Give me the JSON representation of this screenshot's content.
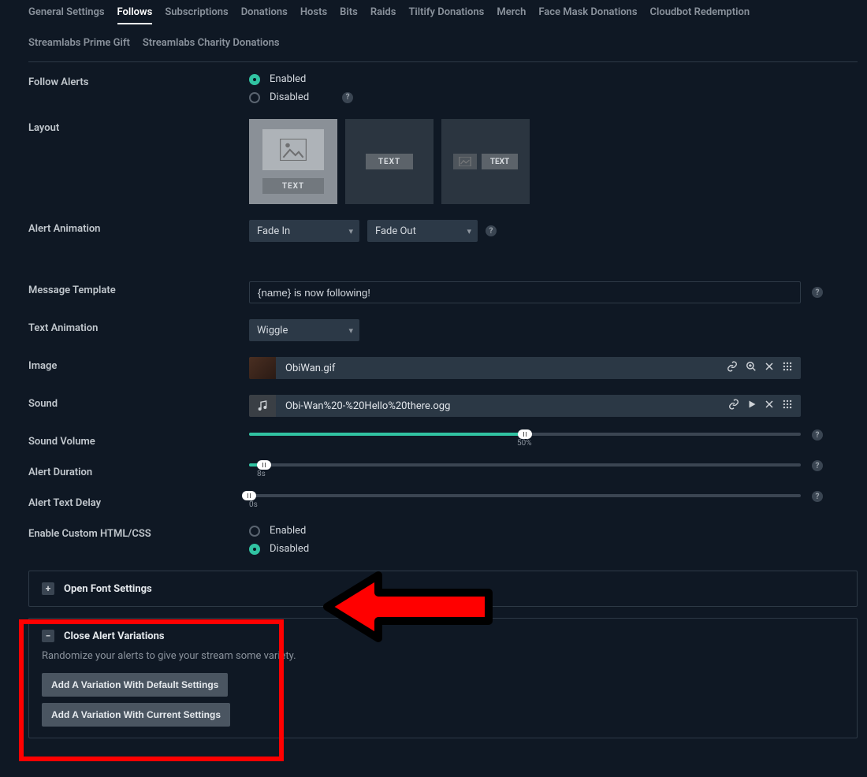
{
  "tabs": [
    "General Settings",
    "Follows",
    "Subscriptions",
    "Donations",
    "Hosts",
    "Bits",
    "Raids",
    "Tiltify Donations",
    "Merch",
    "Face Mask Donations",
    "Cloudbot Redemption",
    "Streamlabs Prime Gift",
    "Streamlabs Charity Donations"
  ],
  "active_tab_index": 1,
  "sections": {
    "follow_alerts": {
      "label": "Follow Alerts",
      "enabled": "Enabled",
      "disabled": "Disabled",
      "value": "enabled"
    },
    "layout": {
      "label": "Layout",
      "text_badge": "TEXT"
    },
    "alert_animation": {
      "label": "Alert Animation",
      "in": "Fade In",
      "out": "Fade Out"
    },
    "message_template": {
      "label": "Message Template",
      "value": "{name} is now following!"
    },
    "text_animation": {
      "label": "Text Animation",
      "value": "Wiggle"
    },
    "image": {
      "label": "Image",
      "file": "ObiWan.gif"
    },
    "sound": {
      "label": "Sound",
      "file": "Obi-Wan%20-%20Hello%20there.ogg"
    },
    "sound_volume": {
      "label": "Sound Volume",
      "value": 50,
      "display": "50%"
    },
    "alert_duration": {
      "label": "Alert Duration",
      "value": 8,
      "max": 300,
      "display": "8s"
    },
    "alert_text_delay": {
      "label": "Alert Text Delay",
      "value": 0,
      "max": 300,
      "display": "0s"
    },
    "custom_html": {
      "label": "Enable Custom HTML/CSS",
      "enabled": "Enabled",
      "disabled": "Disabled",
      "value": "disabled"
    }
  },
  "panels": {
    "font": {
      "title": "Open Font Settings",
      "icon": "+"
    },
    "variations": {
      "title": "Close Alert Variations",
      "icon": "−",
      "desc": "Randomize your alerts to give your stream some variety.",
      "btn_default": "Add A Variation With Default Settings",
      "btn_current": "Add A Variation With Current Settings"
    }
  }
}
